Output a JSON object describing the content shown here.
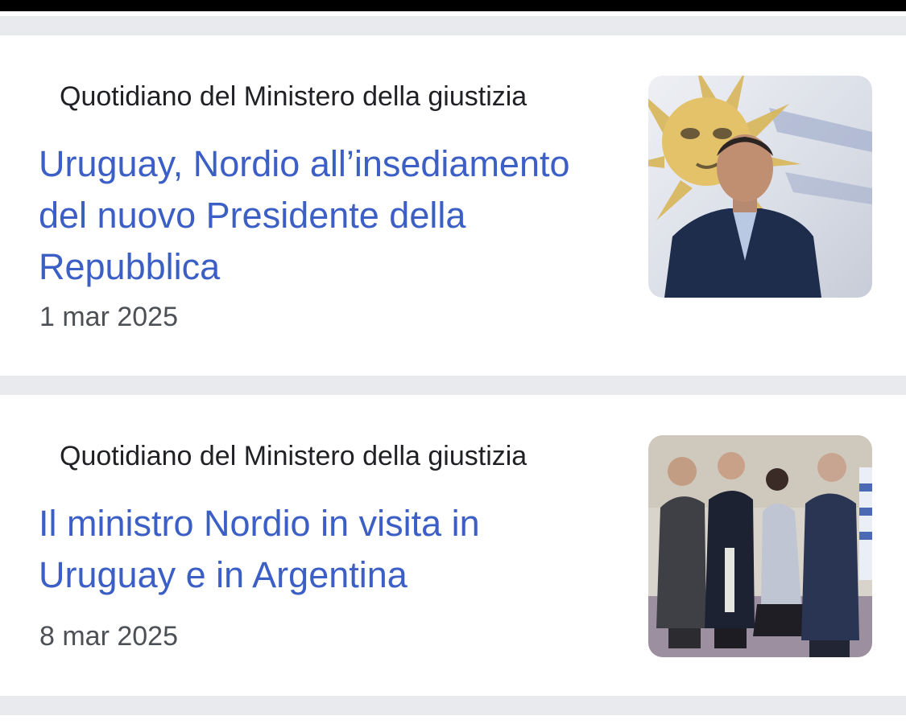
{
  "results": [
    {
      "source": "Quotidiano del Ministero della giustizia",
      "title": "Uruguay, Nordio all’insediamento del nuovo Presidente della Repubblica",
      "date": "1 mar 2025",
      "image": "uruguay-sun-portrait"
    },
    {
      "source": "Quotidiano del Ministero della giustizia",
      "title": "Il ministro Nordio in visita in Uruguay e in Argentina",
      "date": "8 mar 2025",
      "image": "ministers-handshake"
    }
  ]
}
